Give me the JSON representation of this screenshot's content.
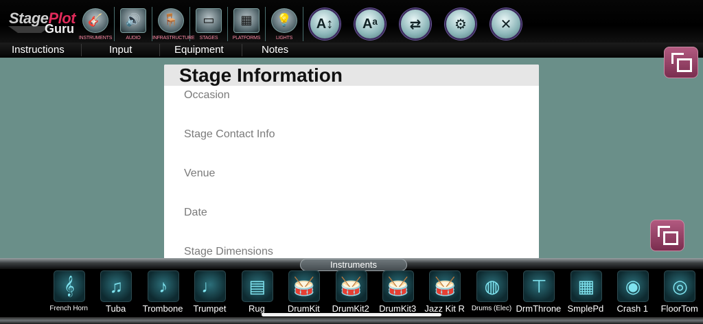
{
  "app": {
    "logo_part1": "Stage",
    "logo_highlight": "Plot",
    "logo_part2": "Guru"
  },
  "categories": [
    {
      "label": "INSTRUMENTS",
      "icon": "guitar-icon",
      "glyph": "🎸"
    },
    {
      "label": "AUDIO",
      "icon": "amplifier-icon",
      "glyph": "🔊"
    },
    {
      "label": "INFRASTRUCTURE",
      "icon": "stool-icon",
      "glyph": "🪑"
    },
    {
      "label": "STAGES",
      "icon": "stage-icon",
      "glyph": "▭"
    },
    {
      "label": "PLATFORMS",
      "icon": "platform-icon",
      "glyph": "▦"
    },
    {
      "label": "LIGHTS",
      "icon": "spotlight-icon",
      "glyph": "💡"
    }
  ],
  "tools": [
    {
      "name": "sort-az-icon",
      "glyph": "A↕"
    },
    {
      "name": "text-size-icon",
      "glyph": "Aᵃ"
    },
    {
      "name": "swap-layout-icon",
      "glyph": "⇄"
    },
    {
      "name": "gear-icon",
      "glyph": "⚙"
    },
    {
      "name": "tools-icon",
      "glyph": "✕"
    }
  ],
  "menu": {
    "instructions": "Instructions",
    "input": "Input",
    "equipment": "Equipment",
    "notes": "Notes"
  },
  "card": {
    "title": "Stage Information",
    "fields": [
      "Occasion",
      "Stage Contact Info",
      "Venue",
      "Date",
      "Stage Dimensions"
    ]
  },
  "tray": {
    "tab_label": "Instruments",
    "items": [
      {
        "label": "French Horn",
        "glyph": "𝄞",
        "small": true
      },
      {
        "label": "Tuba",
        "glyph": "♫"
      },
      {
        "label": "Trombone",
        "glyph": "♪"
      },
      {
        "label": "Trumpet",
        "glyph": "♩"
      },
      {
        "label": "Rug",
        "glyph": "▤"
      },
      {
        "label": "DrumKit",
        "glyph": "🥁"
      },
      {
        "label": "DrumKit2",
        "glyph": "🥁"
      },
      {
        "label": "DrumKit3",
        "glyph": "🥁"
      },
      {
        "label": "Jazz Kit R",
        "glyph": "🥁"
      },
      {
        "label": "Drums (Elec)",
        "glyph": "◍",
        "small": true
      },
      {
        "label": "DrmThrone",
        "glyph": "⊤"
      },
      {
        "label": "SmplePd",
        "glyph": "▦"
      },
      {
        "label": "Crash 1",
        "glyph": "◉"
      },
      {
        "label": "FloorTom",
        "glyph": "◎"
      }
    ]
  }
}
